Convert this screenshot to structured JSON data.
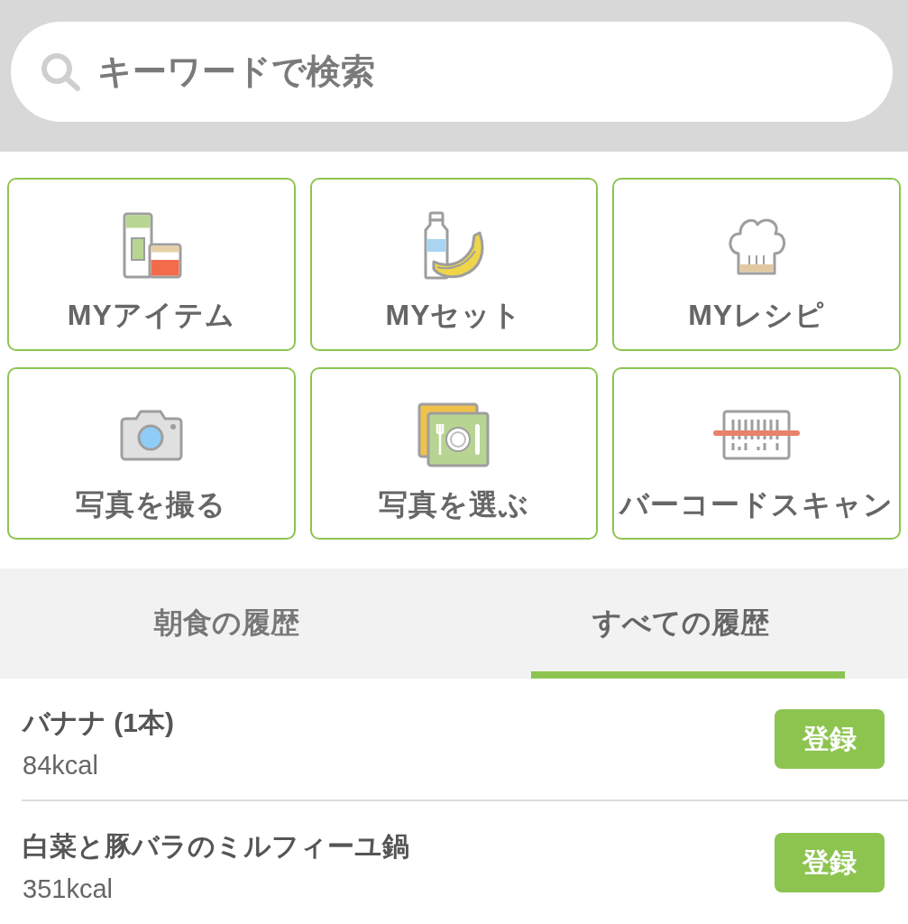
{
  "search": {
    "placeholder": "キーワードで検索"
  },
  "shortcuts": [
    {
      "label": "MYアイテム",
      "kind": "items"
    },
    {
      "label": "MYセット",
      "kind": "set"
    },
    {
      "label": "MYレシピ",
      "kind": "recipe"
    },
    {
      "label": "写真を撮る",
      "kind": "camera"
    },
    {
      "label": "写真を選ぶ",
      "kind": "photo"
    },
    {
      "label": "バーコードスキャン",
      "kind": "barcode"
    }
  ],
  "tabs": [
    {
      "label": "朝食の履歴",
      "selected": false
    },
    {
      "label": "すべての履歴",
      "selected": true
    }
  ],
  "history": [
    {
      "name": "バナナ (1本)",
      "calories": "84kcal",
      "button": "登録"
    },
    {
      "name": "白菜と豚バラのミルフィーユ鍋",
      "calories": "351kcal",
      "button": "登録"
    }
  ]
}
